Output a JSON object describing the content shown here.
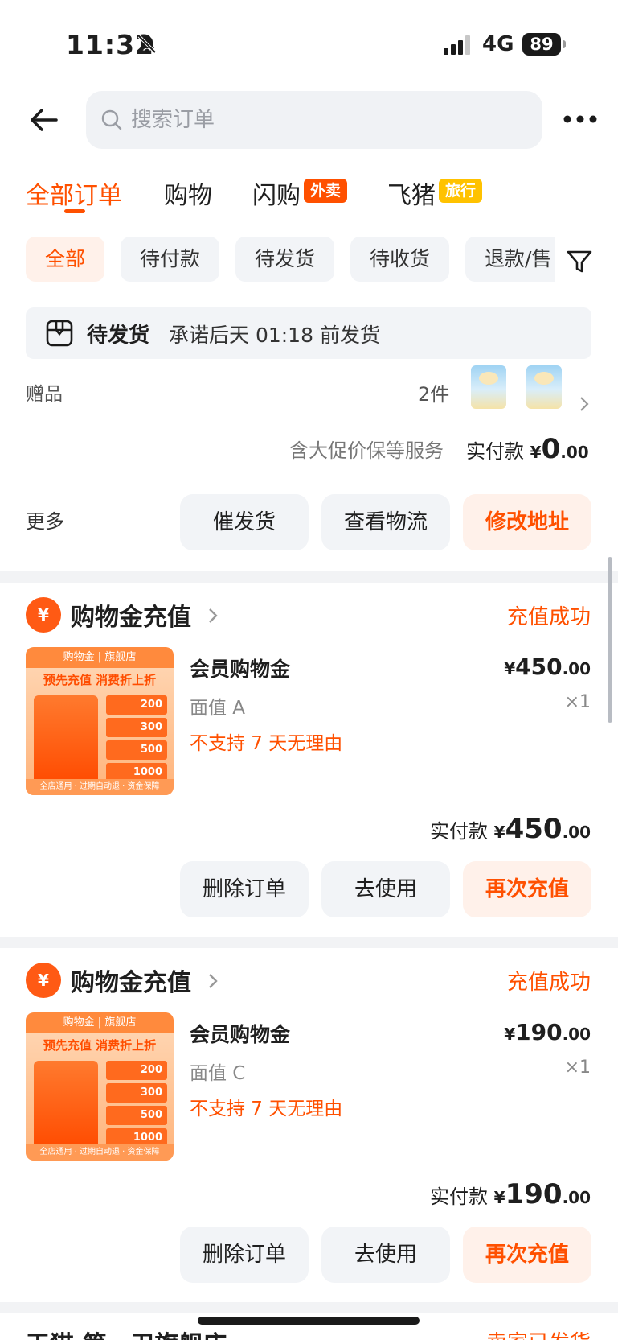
{
  "status_bar": {
    "time": "11:32",
    "network": "4G",
    "battery": "89"
  },
  "search": {
    "placeholder": "搜索订单"
  },
  "tabs": [
    {
      "label": "全部订单"
    },
    {
      "label": "购物"
    },
    {
      "label": "闪购",
      "badge": "外卖"
    },
    {
      "label": "飞猪",
      "badge": "旅行"
    }
  ],
  "chips": [
    "全部",
    "待付款",
    "待发货",
    "待收货",
    "退款/售"
  ],
  "order1": {
    "notice_title": "待发货",
    "notice_text": "承诺后天 01:18 前发货",
    "gift_label": "赠品",
    "gift_count": "2件",
    "service": "含大促价保等服务",
    "pay_label": "实付款",
    "currency": "¥",
    "pay_int": "0",
    "pay_dec": ".00",
    "more": "更多",
    "buttons": [
      "催发货",
      "查看物流",
      "修改地址"
    ]
  },
  "order2": {
    "shop_name": "购物金充值",
    "status": "充值成功",
    "product_name": "会员购物金",
    "currency": "¥",
    "price_int": "450",
    "price_dec": ".00",
    "spec": "面值 A",
    "qty": "×1",
    "warning": "不支持 7 天无理由",
    "pay_label": "实付款",
    "pay_int": "450",
    "pay_dec": ".00",
    "buttons": [
      "删除订单",
      "去使用",
      "再次充值"
    ]
  },
  "order3": {
    "shop_name": "购物金充值",
    "status": "充值成功",
    "product_name": "会员购物金",
    "currency": "¥",
    "price_int": "190",
    "price_dec": ".00",
    "spec": "面值 C",
    "qty": "×1",
    "warning": "不支持 7 天无理由",
    "pay_label": "实付款",
    "pay_int": "190",
    "pay_dec": ".00",
    "buttons": [
      "删除订单",
      "去使用",
      "再次充值"
    ]
  },
  "product_image": {
    "brand": "购物金 | 旗舰店",
    "headline": "预先充值 消费折上折",
    "values": [
      "200",
      "300",
      "500",
      "1000"
    ],
    "footer": "全店通用 · 过期自动退 · 资金保障"
  },
  "order4_partial": {
    "shop_name": "天猫 第一卫旗舰店",
    "status": "卖家已发货"
  },
  "colors": {
    "accent": "#ff5000",
    "accent_bg": "#fff1ea",
    "chip_bg": "#f2f4f7"
  }
}
